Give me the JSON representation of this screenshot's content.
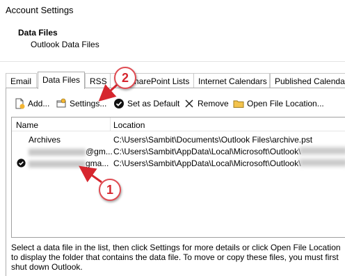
{
  "window": {
    "title": "Account Settings"
  },
  "header": {
    "title": "Data Files",
    "subtitle": "Outlook Data Files"
  },
  "tabs": [
    {
      "label": "Email"
    },
    {
      "label": "Data Files"
    },
    {
      "label": "RSS Feeds"
    },
    {
      "label": "SharePoint Lists"
    },
    {
      "label": "Internet Calendars"
    },
    {
      "label": "Published Calendars"
    }
  ],
  "active_tab": "Data Files",
  "toolbar": {
    "add_label": "Add...",
    "settings_label": "Settings...",
    "set_default_label": "Set as Default",
    "remove_label": "Remove",
    "open_location_label": "Open File Location..."
  },
  "list": {
    "columns": {
      "name": "Name",
      "location": "Location"
    },
    "rows": [
      {
        "name": "Archives",
        "location": "C:\\Users\\Sambit\\Documents\\Outlook Files\\archive.pst",
        "default": false
      },
      {
        "name": "@gm...",
        "location": "C:\\Users\\Sambit\\AppData\\Local\\Microsoft\\Outlook\\",
        "default": false
      },
      {
        "name": "gma...",
        "location": "C:\\Users\\Sambit\\AppData\\Local\\Microsoft\\Outlook\\",
        "default": true
      }
    ]
  },
  "description": "Select a data file in the list, then click Settings for more details or click Open File Location to display the folder that contains the data file. To move or copy these files, you must first shut down Outlook.",
  "annotations": [
    {
      "label": "1"
    },
    {
      "label": "2"
    }
  ],
  "colors": {
    "annotation": "#d6262e",
    "selection_border": "#a0a0a0"
  }
}
